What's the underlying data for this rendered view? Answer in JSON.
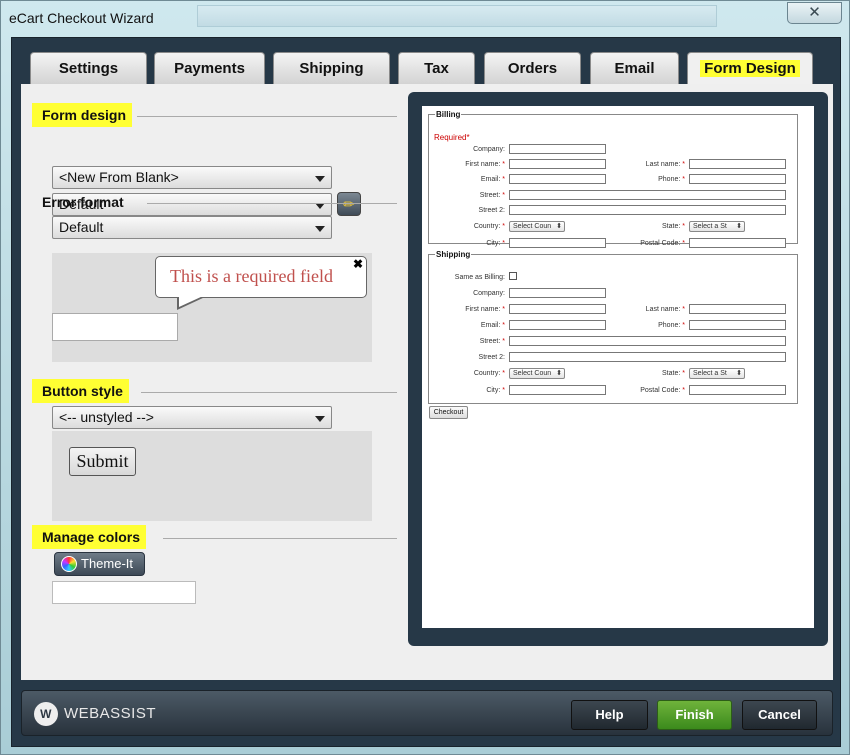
{
  "window": {
    "title": "eCart Checkout Wizard",
    "close_glyph": "✕"
  },
  "tabs": [
    {
      "label": "Settings"
    },
    {
      "label": "Payments"
    },
    {
      "label": "Shipping"
    },
    {
      "label": "Tax"
    },
    {
      "label": "Orders"
    },
    {
      "label": "Email"
    },
    {
      "label": "Form Design",
      "active": true
    }
  ],
  "form_design": {
    "heading": "Form design",
    "template_select": "<New From Blank>",
    "style_select": "Default"
  },
  "error_format": {
    "heading": "Error format",
    "select": "Default",
    "bubble_text": "This is a required field",
    "bubble_close": "✖"
  },
  "button_style": {
    "heading": "Button style",
    "select": "<-- unstyled -->",
    "sample_label": "Submit"
  },
  "manage_colors": {
    "heading": "Manage colors",
    "theme_button": "Theme-It",
    "color_value": ""
  },
  "preview": {
    "billing": {
      "legend": "Billing",
      "required_note": "Required",
      "required_star": "*",
      "company": "Company:",
      "first_name": "First name:",
      "last_name": "Last name:",
      "email": "Email:",
      "phone": "Phone:",
      "street": "Street:",
      "street2": "Street 2:",
      "country": "Country:",
      "country_select": "Select Coun",
      "state": "State:",
      "state_select": "Select a St",
      "city": "City:",
      "postal": "Postal Code:"
    },
    "shipping": {
      "legend": "Shipping",
      "same_as": "Same as Billing:",
      "company": "Company:",
      "first_name": "First name:",
      "last_name": "Last name:",
      "email": "Email:",
      "phone": "Phone:",
      "street": "Street:",
      "street2": "Street 2:",
      "country": "Country:",
      "country_select": "Select Coun",
      "state": "State:",
      "state_select": "Select a St",
      "city": "City:",
      "postal": "Postal Code:"
    },
    "checkout_button": "Checkout"
  },
  "footer": {
    "logo_mark": "W",
    "logo_text": "WEBASSIST",
    "help": "Help",
    "finish": "Finish",
    "cancel": "Cancel"
  },
  "colors": {
    "highlight": "#ffff33",
    "finish_green": "#4a9a25",
    "frame": "#263847"
  }
}
